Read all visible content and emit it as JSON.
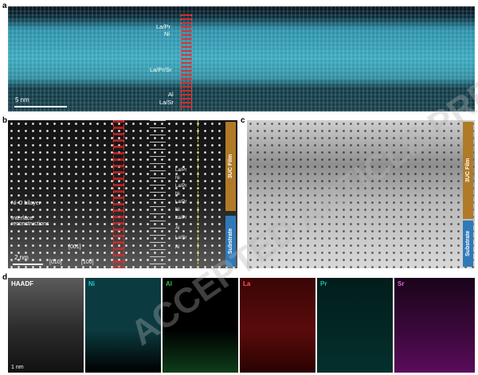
{
  "panel_a": {
    "letter": "a",
    "labels": [
      "La/Pr",
      "Ni",
      "La/Pr/Sr",
      "Al",
      "La/Sr"
    ],
    "scalebar": "5 nm"
  },
  "panel_b": {
    "letter": "b",
    "labels": [
      "Ni-O bilayer",
      "Interface reconstructions",
      "[001]",
      "[010]",
      "[100]"
    ],
    "scalebar": "2 nm",
    "side_labels": {
      "film": "3UC Film",
      "substrate": "Substrate"
    },
    "layer_labels": [
      "La/Pr",
      "Ni",
      "La/Pr",
      "Ni",
      "La/Pr",
      "Ni",
      "La/Pr",
      "Al",
      "La/Sr",
      "Al"
    ]
  },
  "panel_c": {
    "letter": "c",
    "side_labels": {
      "film": "3UC Film",
      "substrate": "Substrate"
    }
  },
  "panel_d": {
    "letter": "d",
    "tiles": [
      {
        "label": "HAADF",
        "color": "#ffffff"
      },
      {
        "label": "Ni",
        "color": "#24c6d6"
      },
      {
        "label": "Al",
        "color": "#33c24a"
      },
      {
        "label": "La",
        "color": "#e02424"
      },
      {
        "label": "Pr",
        "color": "#1fbfb0"
      },
      {
        "label": "Sr",
        "color": "#c23ac2"
      }
    ],
    "scalebar": "1 nm"
  },
  "watermark": "ACCEPTED ARTICLE PREVIEW"
}
